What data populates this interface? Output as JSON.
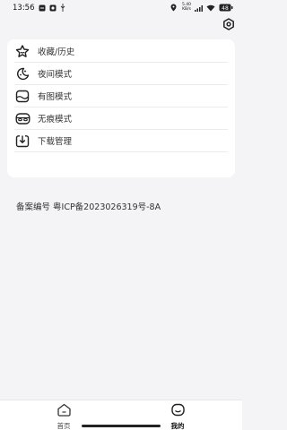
{
  "status_bar": {
    "time": "13:56",
    "net_speed_value": "5.40",
    "net_speed_unit": "KB/s",
    "battery": "48"
  },
  "menu": {
    "items": [
      {
        "label": "收藏/历史",
        "icon": "star-box-icon"
      },
      {
        "label": "夜间模式",
        "icon": "moon-icon"
      },
      {
        "label": "有图模式",
        "icon": "image-box-icon"
      },
      {
        "label": "无痕模式",
        "icon": "mask-icon"
      },
      {
        "label": "下载管理",
        "icon": "download-box-icon"
      }
    ],
    "beian": "备案编号 粤ICP备2023026319号-8A"
  },
  "bottom_nav": {
    "home_label": "首页",
    "mine_label": "我的",
    "active": "mine"
  },
  "colors": {
    "background": "#f4f4f6",
    "card": "#ffffff",
    "icon": "#222222"
  }
}
